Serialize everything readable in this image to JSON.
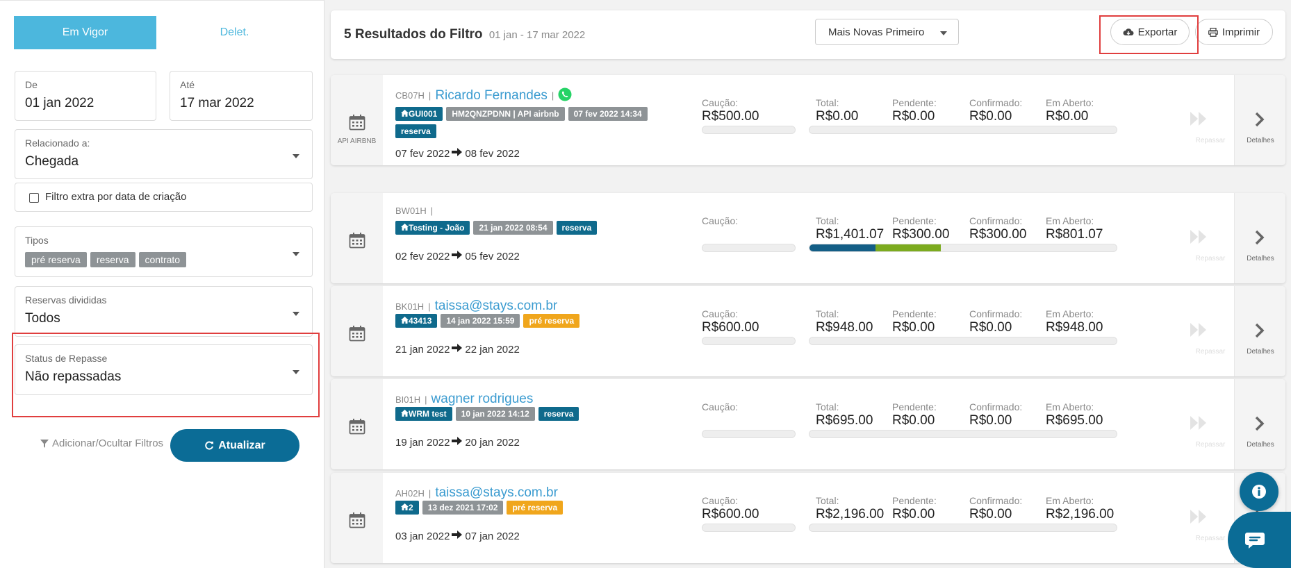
{
  "sidebar": {
    "tabs": {
      "active": "Em Vigor",
      "inactive": "Delet."
    },
    "de": {
      "label": "De",
      "value": "01 jan 2022"
    },
    "ate": {
      "label": "Até",
      "value": "17 mar 2022"
    },
    "relacionado": {
      "label": "Relacionado a:",
      "value": "Chegada"
    },
    "filtro_extra": "Filtro extra por data de criação",
    "tipos": {
      "label": "Tipos",
      "chips": [
        "pré reserva",
        "reserva",
        "contrato"
      ]
    },
    "reservas_divididas": {
      "label": "Reservas divididas",
      "value": "Todos"
    },
    "status_repasse": {
      "label": "Status de Repasse",
      "value": "Não repassadas"
    },
    "filters_link": "Adicionar/Ocultar Filtros",
    "update_button": "Atualizar"
  },
  "header": {
    "title": "5 Resultados do Filtro",
    "range": "01 jan - 17 mar 2022",
    "sort": "Mais Novas Primeiro",
    "export": "Exportar",
    "print": "Imprimir"
  },
  "labels": {
    "caucao": "Caução:",
    "total": "Total:",
    "pendente": "Pendente:",
    "confirmado": "Confirmado:",
    "em_aberto": "Em Aberto:",
    "repassar": "Repassar",
    "detalhes": "Detalhes"
  },
  "results": [
    {
      "code": "CB07H",
      "guest": "Ricardo Fernandes",
      "source": "API AIRBNB",
      "tags": [
        "GUI001",
        "HM2QNZPDNN | API airbnb",
        "07 fev 2022 14:34",
        "reserva"
      ],
      "checkin": "07 fev 2022",
      "checkout": "08 fev 2022",
      "caucao": "R$500.00",
      "total": "R$0.00",
      "pendente": "R$0.00",
      "confirmado": "R$0.00",
      "em_aberto": "R$0.00",
      "confirmed_share": 0,
      "pending_share": 0
    },
    {
      "code": "BW01H",
      "guest": "",
      "tags": [
        "Testing - João",
        "21 jan 2022 08:54",
        "reserva"
      ],
      "checkin": "02 fev 2022",
      "checkout": "05 fev 2022",
      "caucao": "",
      "total": "R$1,401.07",
      "pendente": "R$300.00",
      "confirmado": "R$300.00",
      "em_aberto": "R$801.07",
      "confirmed_share": 0.214,
      "pending_share": 0.214
    },
    {
      "code": "BK01H",
      "guest": "taissa@stays.com.br",
      "tags": [
        "43413",
        "14 jan 2022 15:59",
        "pré reserva"
      ],
      "checkin": "21 jan 2022",
      "checkout": "22 jan 2022",
      "caucao": "R$600.00",
      "total": "R$948.00",
      "pendente": "R$0.00",
      "confirmado": "R$0.00",
      "em_aberto": "R$948.00",
      "confirmed_share": 0,
      "pending_share": 0
    },
    {
      "code": "BI01H",
      "guest": "wagner rodrigues",
      "tags": [
        "WRM test",
        "10 jan 2022 14:12",
        "reserva"
      ],
      "checkin": "19 jan 2022",
      "checkout": "20 jan 2022",
      "caucao": "",
      "total": "R$695.00",
      "pendente": "R$0.00",
      "confirmado": "R$0.00",
      "em_aberto": "R$695.00",
      "confirmed_share": 0,
      "pending_share": 0
    },
    {
      "code": "AH02H",
      "guest": "taissa@stays.com.br",
      "tags": [
        "2",
        "13 dez 2021 17:02",
        "pré reserva"
      ],
      "checkin": "03 jan 2022",
      "checkout": "07 jan 2022",
      "caucao": "R$600.00",
      "total": "R$2,196.00",
      "pendente": "R$0.00",
      "confirmado": "R$0.00",
      "em_aberto": "R$2,196.00",
      "confirmed_share": 0,
      "pending_share": 0
    }
  ]
}
